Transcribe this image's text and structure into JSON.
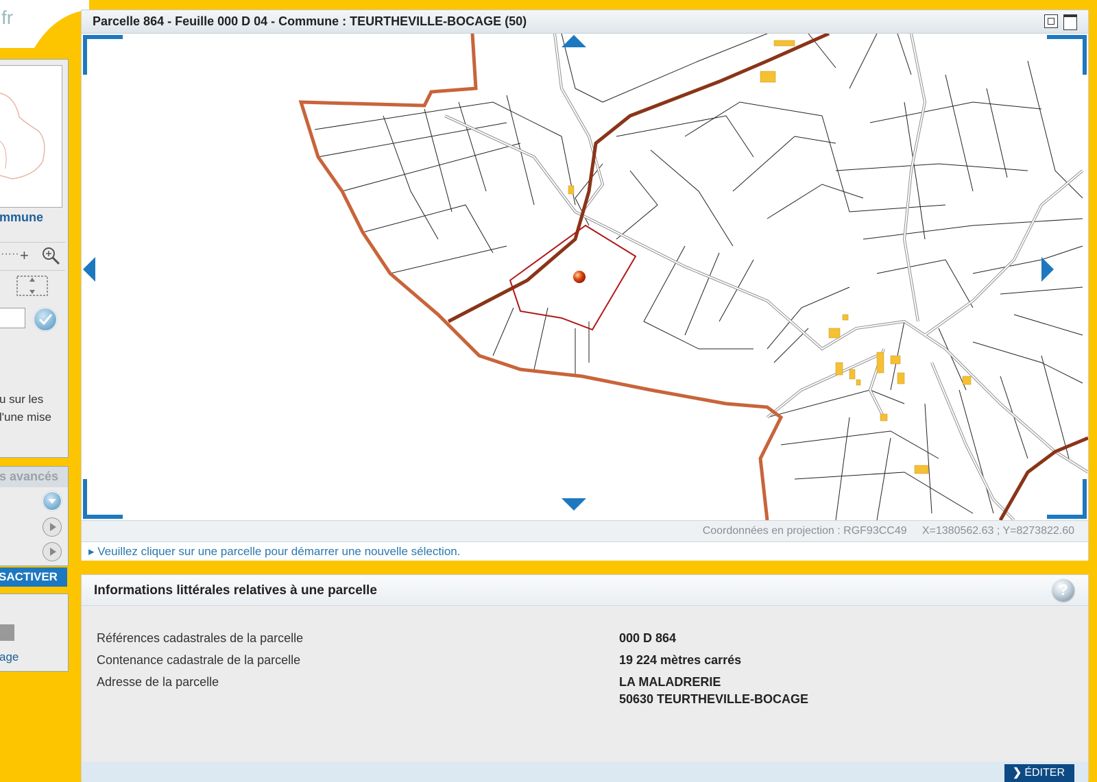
{
  "sidebar": {
    "logo_text": "fr",
    "commune_label": "mmune",
    "help_text_line1": "u sur les",
    "help_text_line2": "l'une mise",
    "advanced_label": "s avancés",
    "deactivate_label": "SACTIVER",
    "page_link": "age",
    "zoom_dots": "·····",
    "zoom_plus": "+"
  },
  "map": {
    "title": "Parcelle 864 - Feuille 000 D 04 - Commune : TEURTHEVILLE-BOCAGE (50)",
    "coords": "Coordonnées en projection : RGF93CC49     X=1380562.63 ; Y=8273822.60",
    "hint": "▸ Veuillez cliquer sur une parcelle pour démarrer une nouvelle sélection.",
    "colors": {
      "commune_boundary": "#c8643a",
      "road": "#8a3418",
      "selected_parcel": "#b01818",
      "building": "#f5c032",
      "frame_accent": "#1d78c0"
    }
  },
  "info": {
    "title": "Informations littérales relatives à une parcelle",
    "help_icon": "?",
    "rows": [
      {
        "label": "Références cadastrales de la parcelle",
        "value": "000 D 864"
      },
      {
        "label": "Contenance cadastrale de la parcelle",
        "value": "19 224 mètres carrés"
      },
      {
        "label": "Adresse de la parcelle",
        "value": "LA MALADRERIE",
        "value2": "50630 TEURTHEVILLE-BOCAGE"
      }
    ],
    "edit_label": "ÉDITER"
  }
}
